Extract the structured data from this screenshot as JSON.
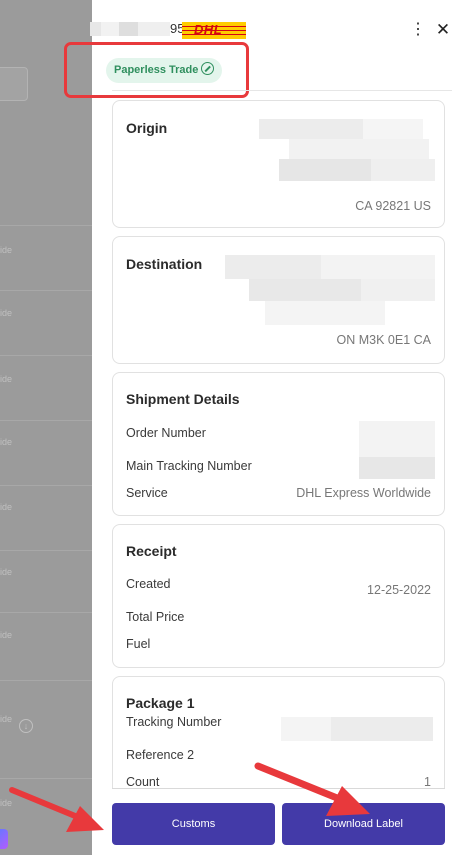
{
  "background": {
    "row_suffix": "ide"
  },
  "header": {
    "tracking_suffix": "95",
    "carrier_logo_text": "DHL",
    "badge_label": "Paperless Trade"
  },
  "origin": {
    "title": "Origin",
    "postal_line": "CA 92821 US"
  },
  "destination": {
    "title": "Destination",
    "postal_line": "ON M3K 0E1 CA"
  },
  "shipment": {
    "title": "Shipment Details",
    "rows": [
      {
        "label": "Order Number",
        "value": ""
      },
      {
        "label": "Main Tracking Number",
        "value": ""
      },
      {
        "label": "Service",
        "value": "DHL Express Worldwide"
      }
    ]
  },
  "receipt": {
    "title": "Receipt",
    "rows": [
      {
        "label": "Created",
        "value": "12-25-2022"
      },
      {
        "label": "Total Price",
        "value": ""
      },
      {
        "label": "Fuel",
        "value": ""
      }
    ]
  },
  "package": {
    "title": "Package 1",
    "rows": [
      {
        "label": "Tracking Number",
        "value": ""
      },
      {
        "label": "Reference 2",
        "value": ""
      },
      {
        "label": "Count",
        "value": "1"
      }
    ]
  },
  "actions": {
    "customs_label": "Customs",
    "download_label": "Download Label"
  },
  "colors": {
    "primary_button": "#433aa8",
    "badge_bg": "#e3f5ec",
    "badge_text": "#2f8f5e",
    "dhl_yellow": "#ffcc00",
    "dhl_red": "#d40511",
    "annotation_red": "#e8393c"
  }
}
